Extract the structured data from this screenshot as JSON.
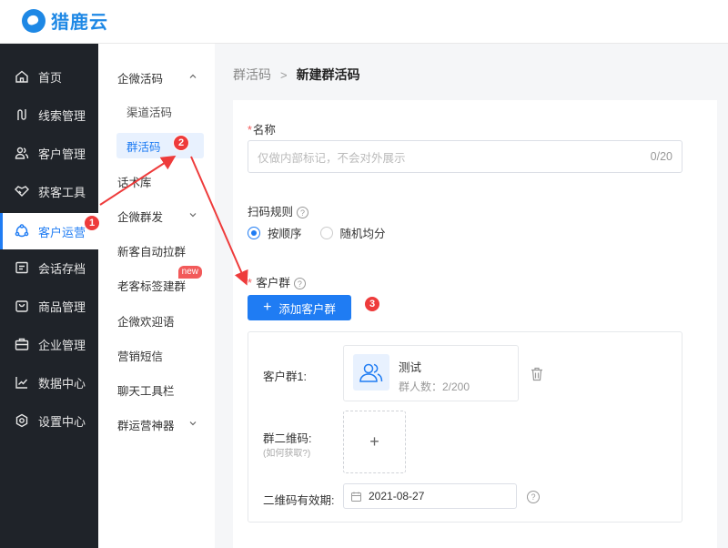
{
  "app": {
    "name": "猎鹿云"
  },
  "sidebar": {
    "items": [
      {
        "label": "首页",
        "icon": "home-icon"
      },
      {
        "label": "线索管理",
        "icon": "route-icon"
      },
      {
        "label": "客户管理",
        "icon": "users-icon"
      },
      {
        "label": "获客工具",
        "icon": "handshake-icon"
      },
      {
        "label": "客户运营",
        "icon": "operation-icon"
      },
      {
        "label": "会话存档",
        "icon": "chat-archive-icon"
      },
      {
        "label": "商品管理",
        "icon": "bag-icon"
      },
      {
        "label": "企业管理",
        "icon": "briefcase-icon"
      },
      {
        "label": "数据中心",
        "icon": "chart-icon"
      },
      {
        "label": "设置中心",
        "icon": "settings-icon"
      }
    ],
    "active_index": 4
  },
  "submenu": {
    "items": [
      {
        "label": "企微活码"
      },
      {
        "label": "渠道活码"
      },
      {
        "label": "群活码"
      },
      {
        "label": "话术库"
      },
      {
        "label": "企微群发"
      },
      {
        "label": "新客自动拉群"
      },
      {
        "label": "老客标签建群"
      },
      {
        "label": "企微欢迎语"
      },
      {
        "label": "营销短信"
      },
      {
        "label": "聊天工具栏"
      },
      {
        "label": "群运营神器"
      }
    ],
    "new_badge": "new"
  },
  "breadcrumb": {
    "parent": "群活码",
    "separator": ">",
    "current": "新建群活码"
  },
  "form": {
    "required_mark": "*",
    "name_label": "名称",
    "name_placeholder": "仅做内部标记，不会对外展示",
    "name_counter": "0/20",
    "scan_rule_label": "扫码规则",
    "help_glyph": "?",
    "scan_rule_options": [
      {
        "label": "按顺序",
        "selected": true
      },
      {
        "label": "随机均分",
        "selected": false
      }
    ],
    "customer_group_label": "客户群",
    "add_group_button": "添加客户群",
    "group_box": {
      "group_label": "客户群1:",
      "group_name": "测试",
      "group_members": "群人数：2/200",
      "qr_label": "群二维码:",
      "qr_hint": "(如何获取?)",
      "upload_plus": "+",
      "validity_label": "二维码有效期:",
      "validity_date": "2021-08-27"
    }
  },
  "annotations": {
    "step1": "1",
    "step2": "2",
    "step3": "3",
    "color": "#ee3b3b"
  },
  "colors": {
    "primary": "#1f7cf3",
    "sidebar_bg": "#1f2329",
    "brand": "#1e88e5"
  }
}
